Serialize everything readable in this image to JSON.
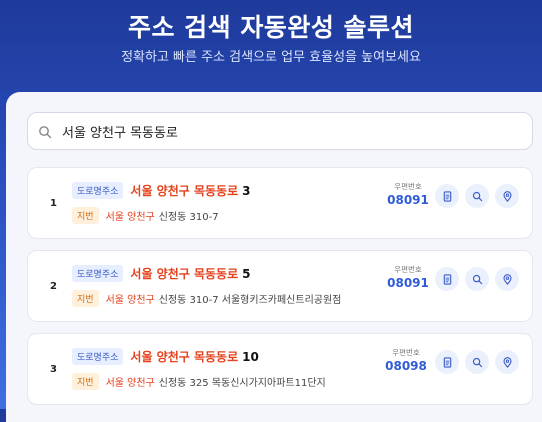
{
  "header": {
    "title": "주소 검색 자동완성 솔루션",
    "subtitle": "정확하고 빠른 주소 검색으로 업무 효율성을 높여보세요"
  },
  "search": {
    "value": "서울 양천구 목동동로",
    "icon": "search-icon"
  },
  "labels": {
    "road_badge": "도로명주소",
    "jibun_badge": "지번",
    "postal_label": "우편번호"
  },
  "results": [
    {
      "index": "1",
      "road_highlight": "서울 양천구 목동동로",
      "road_rest": "3",
      "jibun_highlight": "서울 양천구",
      "jibun_rest": "신정동 310-7",
      "postal_code": "08091"
    },
    {
      "index": "2",
      "road_highlight": "서울 양천구 목동동로",
      "road_rest": "5",
      "jibun_highlight": "서울 양천구",
      "jibun_rest": "신정동 310-7 서울형키즈카페신트리공원점",
      "postal_code": "08091"
    },
    {
      "index": "3",
      "road_highlight": "서울 양천구 목동동로",
      "road_rest": "10",
      "jibun_highlight": "서울 양천구",
      "jibun_rest": "신정동 325 목동신시가지아파트11단지",
      "postal_code": "08098"
    }
  ],
  "actions": [
    "document-icon",
    "search-icon",
    "map-pin-icon"
  ],
  "colors": {
    "header_bg": "#2a4fc0",
    "highlight": "#e4421c",
    "postal": "#2f5bd6",
    "road_badge_bg": "#e6eeff",
    "jibun_badge_bg": "#fff0dc"
  }
}
